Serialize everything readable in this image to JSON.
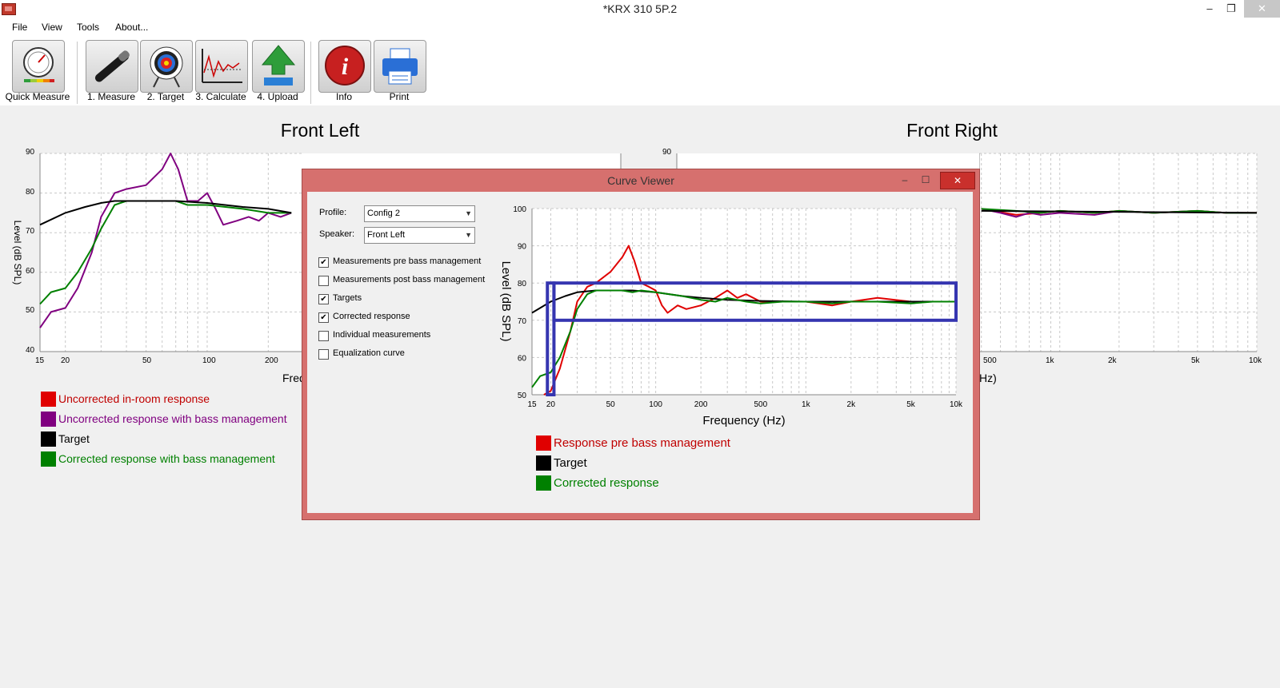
{
  "window": {
    "title": "*KRX 310 5P.2",
    "minimize_glyph": "–",
    "restore_glyph": "❐",
    "close_glyph": "✕"
  },
  "menu": [
    "File",
    "View",
    "Tools",
    "About..."
  ],
  "toolbar": [
    {
      "label": "Quick Measure",
      "icon": "gauge-icon"
    },
    {
      "label": "1. Measure",
      "icon": "microphone-icon"
    },
    {
      "label": "2. Target",
      "icon": "target-icon"
    },
    {
      "label": "3. Calculate",
      "icon": "graph-icon"
    },
    {
      "label": "4. Upload",
      "icon": "upload-arrow-icon"
    },
    {
      "label": "Info",
      "icon": "info-icon"
    },
    {
      "label": "Print",
      "icon": "printer-icon"
    }
  ],
  "main_charts": {
    "left": {
      "title": "Front Left",
      "y_ticks": [
        "90",
        "80",
        "70",
        "60",
        "50",
        "40"
      ],
      "x_ticks": [
        "15",
        "20",
        "50",
        "100",
        "200"
      ],
      "ylabel": "Level (dB SPL)",
      "xlabel_visible": "Freq"
    },
    "right": {
      "title": "Front Right",
      "y_ticks": [
        "90"
      ],
      "x_ticks": [
        "500",
        "1k",
        "2k",
        "5k",
        "10k"
      ],
      "xlabel_visible": "Hz)"
    }
  },
  "main_legend": [
    {
      "label": "Uncorrected in-room response",
      "color": "#e00000"
    },
    {
      "label": "Uncorrected response with bass management",
      "color": "#800080"
    },
    {
      "label": "Target",
      "color": "#000000"
    },
    {
      "label": "Corrected response with bass management",
      "color": "#008000"
    }
  ],
  "dialog": {
    "title": "Curve Viewer",
    "min_glyph": "–",
    "max_glyph": "☐",
    "close_glyph": "✕",
    "profile_label": "Profile:",
    "profile_value": "Config 2",
    "speaker_label": "Speaker:",
    "speaker_value": "Front Left",
    "dropdown_arrow": "▼",
    "checkboxes": [
      {
        "label": "Measurements pre bass management",
        "checked": "✔"
      },
      {
        "label": "Measurements post bass management",
        "checked": ""
      },
      {
        "label": "Targets",
        "checked": "✔"
      },
      {
        "label": "Corrected response",
        "checked": "✔"
      },
      {
        "label": "Individual measurements",
        "checked": ""
      },
      {
        "label": "Equalization curve",
        "checked": ""
      }
    ],
    "legend": [
      {
        "label": "Response pre bass management",
        "color": "#e00000"
      },
      {
        "label": "Target",
        "color": "#000000"
      },
      {
        "label": "Corrected response",
        "color": "#008000"
      }
    ]
  },
  "chart_data": [
    {
      "type": "line",
      "title": "Front Left",
      "ylabel": "Level (dB SPL)",
      "x_scale": "log",
      "ylim": [
        40,
        90
      ],
      "grid": true,
      "series": [
        {
          "name": "Uncorrected response with bass management",
          "color": "#800080",
          "x": [
            15,
            17,
            20,
            23,
            27,
            30,
            35,
            40,
            50,
            60,
            66,
            72,
            80,
            90,
            100,
            110,
            120,
            140,
            160,
            180,
            200,
            230,
            260
          ],
          "y": [
            46,
            50,
            51,
            56,
            65,
            74,
            80,
            81,
            82,
            86,
            90,
            86,
            78,
            78,
            80,
            76,
            72,
            73,
            74,
            73,
            75,
            74,
            75
          ]
        },
        {
          "name": "Corrected response with bass management",
          "color": "#008000",
          "x": [
            15,
            17,
            20,
            23,
            27,
            30,
            35,
            40,
            50,
            60,
            70,
            80,
            100,
            150,
            200,
            260
          ],
          "y": [
            52,
            55,
            56,
            60,
            66,
            71,
            77,
            78,
            78,
            78,
            78,
            77,
            77,
            76,
            75,
            75
          ]
        },
        {
          "name": "Target",
          "color": "#000000",
          "x": [
            15,
            20,
            25,
            30,
            35,
            40,
            50,
            70,
            100,
            150,
            200,
            260
          ],
          "y": [
            72,
            75,
            76.5,
            77.5,
            78,
            78,
            78,
            78,
            77.5,
            76.5,
            76,
            75
          ]
        }
      ]
    },
    {
      "type": "line",
      "title": "Front Right",
      "x_scale": "log",
      "grid": true,
      "series": [
        {
          "name": "Uncorrected in-room response",
          "color": "#e00000",
          "x": [
            400,
            600,
            800,
            1000,
            1500,
            2000,
            3000,
            5000,
            7000,
            10000
          ],
          "y": [
            76,
            74.5,
            75,
            75.5,
            75,
            75.5,
            75,
            75.5,
            75,
            75
          ]
        },
        {
          "name": "Uncorrected response with bass management",
          "color": "#800080",
          "x": [
            400,
            500,
            600,
            700,
            800,
            1000,
            1500,
            2000,
            3000,
            5000,
            7000,
            10000
          ],
          "y": [
            76,
            75,
            74,
            75,
            74.5,
            75,
            74.5,
            75.5,
            75,
            75.5,
            75,
            75
          ]
        },
        {
          "name": "Corrected response with bass management",
          "color": "#008000",
          "x": [
            400,
            600,
            800,
            1000,
            1500,
            2000,
            3000,
            5000,
            7000,
            10000
          ],
          "y": [
            76,
            75.5,
            75,
            75.5,
            75,
            75.5,
            75,
            75.5,
            75,
            75
          ]
        },
        {
          "name": "Target",
          "color": "#000000",
          "x": [
            400,
            10000
          ],
          "y": [
            75.5,
            75
          ]
        }
      ]
    },
    {
      "type": "line",
      "title": "",
      "xlabel": "Frequency (Hz)",
      "ylabel": "Level (dB SPL)",
      "x_scale": "log",
      "xlim": [
        15,
        10000
      ],
      "ylim": [
        50,
        100
      ],
      "x_ticks": [
        "15",
        "20",
        "50",
        "100",
        "200",
        "500",
        "1k",
        "2k",
        "5k",
        "10k"
      ],
      "y_ticks": [
        "100",
        "90",
        "80",
        "70",
        "60",
        "50"
      ],
      "grid": true,
      "series": [
        {
          "name": "Response pre bass management",
          "color": "#e00000",
          "x": [
            18,
            20,
            23,
            27,
            30,
            35,
            40,
            50,
            60,
            66,
            72,
            80,
            90,
            100,
            110,
            120,
            140,
            160,
            200,
            250,
            300,
            350,
            400,
            500,
            700,
            1000,
            1500,
            2000,
            3000,
            5000,
            7000,
            10000
          ],
          "y": [
            50,
            51,
            57,
            67,
            75,
            79,
            80,
            83,
            87,
            90,
            86,
            80,
            79,
            78,
            74,
            72,
            74,
            73,
            74,
            76,
            78,
            76,
            77,
            75,
            75,
            75,
            74,
            75,
            76,
            75,
            75,
            75
          ]
        },
        {
          "name": "Target",
          "color": "#000000",
          "x": [
            15,
            20,
            25,
            30,
            40,
            50,
            70,
            100,
            150,
            200,
            300,
            500,
            1000,
            2000,
            5000,
            10000
          ],
          "y": [
            72,
            75,
            76.5,
            77.5,
            78,
            78,
            78,
            77.5,
            76.5,
            76,
            75.5,
            75.2,
            75,
            75,
            75,
            75
          ]
        },
        {
          "name": "Corrected response",
          "color": "#008000",
          "x": [
            15,
            17,
            20,
            23,
            27,
            30,
            35,
            40,
            50,
            60,
            70,
            80,
            100,
            150,
            200,
            250,
            300,
            400,
            500,
            700,
            1000,
            1500,
            2000,
            3000,
            5000,
            7000,
            10000
          ],
          "y": [
            52,
            55,
            56,
            60,
            67,
            73,
            77,
            78,
            78,
            78,
            77.5,
            78,
            77.5,
            76.5,
            75.5,
            75,
            76,
            75,
            74.5,
            75,
            75,
            74.5,
            75,
            75,
            74.5,
            75,
            75
          ]
        }
      ],
      "highlights": [
        {
          "x": [
            19,
            21
          ],
          "y": [
            50,
            80
          ]
        },
        {
          "x": [
            21,
            10000
          ],
          "y": [
            70,
            80
          ]
        }
      ]
    }
  ]
}
